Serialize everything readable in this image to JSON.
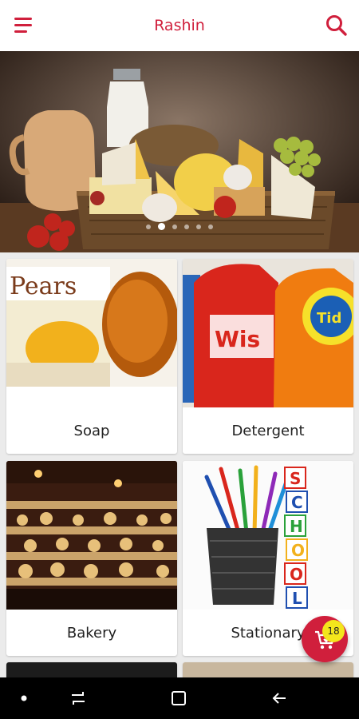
{
  "app": {
    "title": "Rashin",
    "accent_color": "#d01f3c",
    "menu_icon": "hamburger-menu-icon",
    "search_icon": "search-icon"
  },
  "banner": {
    "slides_count": 6,
    "active_slide": 2
  },
  "categories": [
    {
      "label": "Soap"
    },
    {
      "label": "Detergent"
    },
    {
      "label": "Bakery"
    },
    {
      "label": "Stationary"
    }
  ],
  "cart": {
    "count": "18",
    "icon": "cart-icon"
  },
  "navbar": {
    "icons": [
      "dot-icon",
      "recents-icon",
      "home-square-icon",
      "back-icon"
    ]
  }
}
